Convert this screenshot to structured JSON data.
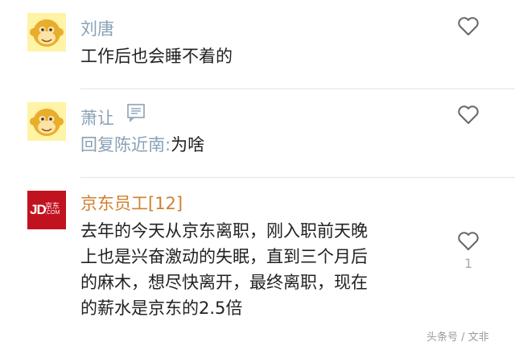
{
  "comments": [
    {
      "user": "刘唐",
      "text": "工作后也会睡不着的",
      "avatar": "monkey-avatar"
    },
    {
      "user": "萧让",
      "reply_prefix": "回复陈近南:",
      "text": "为啥",
      "avatar": "monkey-avatar",
      "name_icon": "message-icon"
    },
    {
      "user": "京东员工[12]",
      "avatar": "jd-logo",
      "logo": {
        "letters": "JD",
        "cn": "京东",
        "com": ".COM"
      },
      "text_lines": [
        "去年的今天从京东离职，刚入职前天晚",
        "上也是兴奋激动的失眠，直到三个月后",
        "的麻木，想尽快离开，最终离职，现在",
        "的薪水是京东的2.5倍"
      ],
      "like_count": "1"
    }
  ],
  "colors": {
    "username": "#8aa1b6",
    "username_highlight": "#d0802f",
    "text": "#222222",
    "divider": "#e3e3e3",
    "jd_red": "#c1121f"
  },
  "watermark": "头条号 / 文非"
}
